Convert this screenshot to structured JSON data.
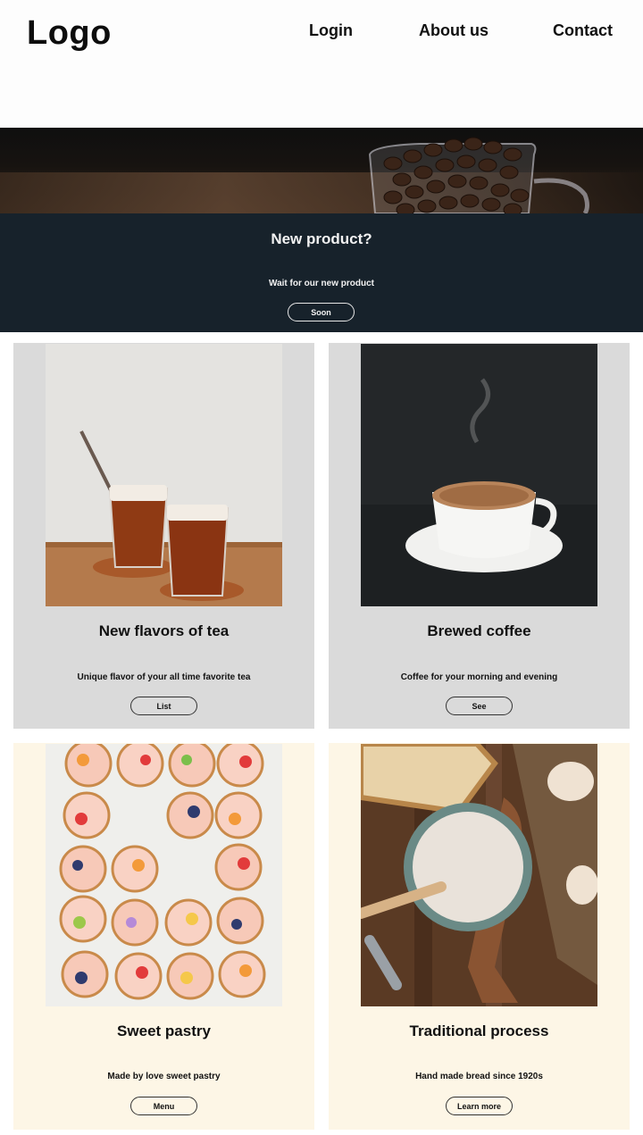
{
  "header": {
    "logo": "Logo",
    "nav": {
      "login": "Login",
      "about": "About us",
      "contact": "Contact"
    }
  },
  "hero": {
    "title": "New product?",
    "subtitle": "Wait for our new product",
    "button": "Soon"
  },
  "cards": [
    {
      "title": "New flavors of tea",
      "description": "Unique flavor of your all time favorite tea",
      "button": "List"
    },
    {
      "title": "Brewed coffee",
      "description": "Coffee for your morning and evening",
      "button": "See"
    },
    {
      "title": "Sweet pastry",
      "description": "Made by love sweet pastry",
      "button": "Menu"
    },
    {
      "title": "Traditional process",
      "description": "Hand made bread since 1920s",
      "button": "Learn more"
    }
  ],
  "colors": {
    "banner": "#17222b",
    "card_gray": "#dadada",
    "card_cream": "#fdf6e6"
  }
}
